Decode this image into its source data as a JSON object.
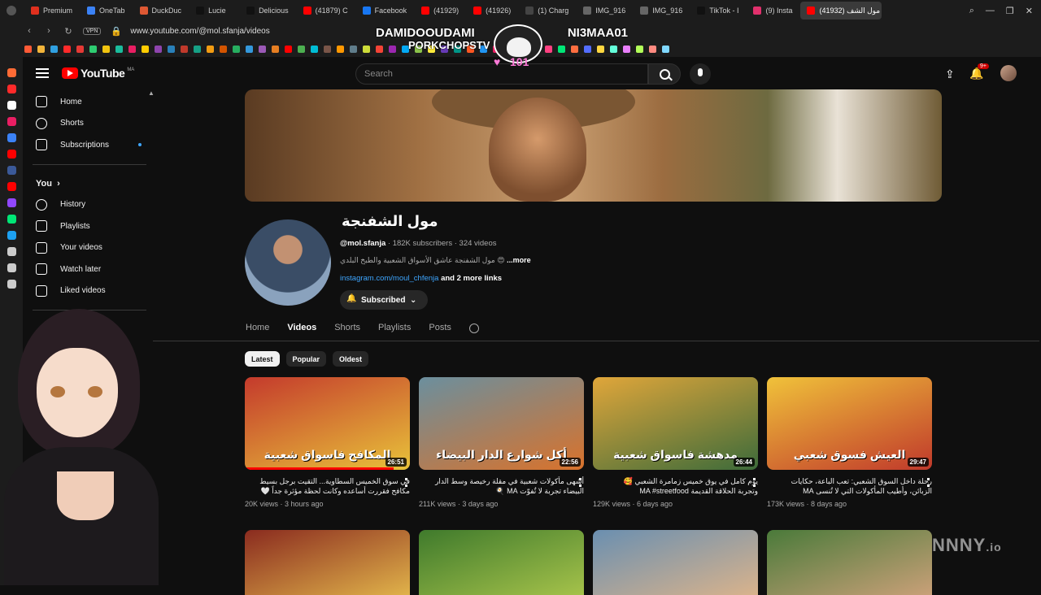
{
  "browser": {
    "tabs": [
      {
        "label": "Premium",
        "color": "#e0301e"
      },
      {
        "label": "OneTab",
        "color": "#3b82f6"
      },
      {
        "label": "DuckDuc",
        "color": "#de5833"
      },
      {
        "label": "Lucie",
        "color": "#111111"
      },
      {
        "label": "Delicious",
        "color": "#111111"
      },
      {
        "label": "(41879) C",
        "color": "#ff0000"
      },
      {
        "label": "Facebook",
        "color": "#1877f2"
      },
      {
        "label": "(41929)",
        "color": "#ff0000"
      },
      {
        "label": "(41926)",
        "color": "#ff0000"
      },
      {
        "label": "(1) Charg",
        "color": "#444444"
      },
      {
        "label": "IMG_916",
        "color": "#666666"
      },
      {
        "label": "IMG_916",
        "color": "#666666"
      },
      {
        "label": "TikTok - I",
        "color": "#111111"
      },
      {
        "label": "(9) Insta",
        "color": "#e1306c"
      },
      {
        "label": "(41932) مول الشف",
        "color": "#ff0000",
        "active": true
      }
    ],
    "url": "www.youtube.com/@mol.sfanja/videos",
    "vpn_label": "VPN",
    "window_controls": [
      "⌕",
      "—",
      "❐",
      "✕"
    ],
    "bookmark_colors": [
      "#ff5a36",
      "#f2b43a",
      "#30a0e0",
      "#ff2a2a",
      "#e53935",
      "#2ecc71",
      "#f1c40f",
      "#1abc9c",
      "#e91e63",
      "#ffcc00",
      "#8e44ad",
      "#2980b9",
      "#c0392b",
      "#16a085",
      "#f39c12",
      "#d35400",
      "#27ae60",
      "#3498db",
      "#9b59b6",
      "#e67e22",
      "#ff0000",
      "#4caf50",
      "#00bcd4",
      "#795548",
      "#ff9800",
      "#607d8b",
      "#cddc39",
      "#f44336",
      "#9c27b0",
      "#03a9f4",
      "#8bc34a",
      "#ffeb3b",
      "#673ab7",
      "#009688",
      "#ff5722",
      "#2196f3",
      "#e91e63",
      "#4caf50",
      "#ffc107",
      "#3f51b5",
      "#ff4081",
      "#00e676",
      "#ff6e40",
      "#536dfe",
      "#ffd740",
      "#64ffda",
      "#ea80fc",
      "#b2ff59",
      "#ff8a80",
      "#80d8ff"
    ],
    "side_icon_colors": [
      "#ff6b35",
      "#ff2a2a",
      "#ffffff",
      "#e91e63",
      "#3b82f6",
      "#ff0000",
      "#3b5998",
      "#ff0000",
      "#9147ff",
      "#00e676",
      "#1da1f2",
      "#cccccc",
      "#cccccc",
      "#cccccc"
    ]
  },
  "overlay": {
    "left_name": "DAMIDOOUDAMI",
    "left_sub": "PORKCHOPSTV",
    "right_name": "NI3MAA01",
    "heart": "♥",
    "count": "101"
  },
  "youtube": {
    "logo_text": "YouTube",
    "country_code": "MA",
    "search_placeholder": "Search",
    "notification_badge": "9+",
    "guide": {
      "main": [
        {
          "label": "Home",
          "icon": "home-icon"
        },
        {
          "label": "Shorts",
          "icon": "shorts-icon"
        },
        {
          "label": "Subscriptions",
          "icon": "subscriptions-icon"
        }
      ],
      "you_label": "You",
      "you_items": [
        {
          "label": "History",
          "icon": "history-icon"
        },
        {
          "label": "Playlists",
          "icon": "playlists-icon"
        },
        {
          "label": "Your videos",
          "icon": "your-videos-icon"
        },
        {
          "label": "Watch later",
          "icon": "watch-later-icon"
        },
        {
          "label": "Liked videos",
          "icon": "liked-videos-icon"
        }
      ]
    },
    "channel": {
      "name": "مول الشفنجة",
      "handle": "@mol.sfanja",
      "meta": " · 182K subscribers · 324 videos",
      "description": "مول الشفنجة عاشق الأسواق الشعبية والطبخ البلدي 😍",
      "more": "...more",
      "link": "instagram.com/moul_chfenja",
      "more_links": "and 2 more links",
      "subscribed_label": "Subscribed",
      "tabs": [
        "Home",
        "Videos",
        "Shorts",
        "Playlists",
        "Posts"
      ],
      "active_tab": "Videos"
    },
    "chips": [
      "Latest",
      "Popular",
      "Oldest"
    ],
    "active_chip": "Latest",
    "videos": [
      {
        "title": "في سوق الخميس السطاوية... التقيت برجل بسيط مكافح فقررت أساعده وكانت لحظة مؤثرة جداً 🤍",
        "meta": "20K views · 3 hours ago",
        "duration": "26:51",
        "thumb_text": "المكافح فاسواق شعبية",
        "progress": 0.9,
        "bg": [
          "#c43a2c",
          "#e8c23a"
        ]
      },
      {
        "title": "أشهى مأكولات شعبية في مقلة رخيصة وسط الدار البيضاء تجربة لا تُفوّت MA 🍳",
        "meta": "211K views · 3 days ago",
        "duration": "22:56",
        "thumb_text": "أكل شوارع الدار البيضاء",
        "progress": 0.0,
        "bg": [
          "#6b8f9e",
          "#d9722b"
        ]
      },
      {
        "title": "يوم كامل في يوق خميس زمامرة الشعبي 🥰 وتجربة الحلاقة القديمة MA #streetfood",
        "meta": "129K views · 6 days ago",
        "duration": "26:44",
        "thumb_text": "مدهشة فاسواق شعبية",
        "progress": 0.0,
        "bg": [
          "#e0a63a",
          "#3d6b3a"
        ]
      },
      {
        "title": "رحلة داخل السوق الشعبي: تعب الباعة، حكايات الزبائن، وأطيب المأكولات التي لا تُنسى MA",
        "meta": "173K views · 8 days ago",
        "duration": "29:47",
        "thumb_text": "العيش فسوق شعبي",
        "progress": 0.0,
        "bg": [
          "#f0c23a",
          "#c0392b"
        ]
      }
    ],
    "row2_colors": [
      [
        "#8a2b1f",
        "#e0b24a"
      ],
      [
        "#3f7a2c",
        "#a5c24a"
      ],
      [
        "#6a8fb0",
        "#d9b38c"
      ],
      [
        "#4a7a3a",
        "#c9a078"
      ]
    ]
  },
  "watermark": {
    "main": "NNNY",
    "suffix": ".io"
  }
}
